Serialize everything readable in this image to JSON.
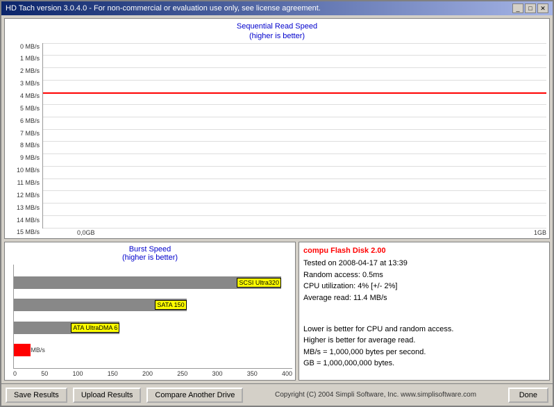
{
  "window": {
    "title": "HD Tach version 3.0.4.0  -  For non-commercial or evaluation use only, see license agreement.",
    "min_btn": "_",
    "max_btn": "□",
    "close_btn": "✕"
  },
  "top_chart": {
    "title_line1": "Sequential Read Speed",
    "title_line2": "(higher is better)",
    "y_labels": [
      "15 MB/s",
      "14 MB/s",
      "13 MB/s",
      "12 MB/s",
      "11 MB/s",
      "10 MB/s",
      "9 MB/s",
      "8 MB/s",
      "7 MB/s",
      "6 MB/s",
      "5 MB/s",
      "4 MB/s",
      "3 MB/s",
      "2 MB/s",
      "1 MB/s",
      "0 MB/s"
    ],
    "x_labels": [
      "0,0GB",
      "1GB"
    ],
    "red_line_pct": 70
  },
  "burst_chart": {
    "title_line1": "Burst Speed",
    "title_line2": "(higher is better)",
    "bars": [
      {
        "label": "SCSI Ultra320",
        "width_pct": 96,
        "color": "gray",
        "value": null
      },
      {
        "label": "SATA 150",
        "width_pct": 62,
        "color": "gray",
        "value": null
      },
      {
        "label": "ATA UltraDMA 6",
        "width_pct": 38,
        "color": "gray",
        "value": null
      },
      {
        "label": null,
        "width_pct": 6,
        "color": "red",
        "value": "11.6 MB/s"
      }
    ],
    "x_labels": [
      "0",
      "50",
      "100",
      "150",
      "200",
      "250",
      "300",
      "350",
      "400"
    ]
  },
  "info_panel": {
    "title": "compu Flash Disk 2.00",
    "line1": "Tested on 2008-04-17 at 13:39",
    "line2": "Random access: 0.5ms",
    "line3": "CPU utilization: 4% [+/- 2%]",
    "line4": "Average read: 11.4 MB/s",
    "separator": "",
    "note1": "Lower is better for CPU and random access.",
    "note2": "Higher is better for average read.",
    "note3": "MB/s = 1,000,000 bytes per second.",
    "note4": "GB = 1,000,000,000 bytes."
  },
  "footer": {
    "save_btn": "Save Results",
    "upload_btn": "Upload Results",
    "compare_btn": "Compare Another Drive",
    "copyright": "Copyright (C) 2004 Simpli Software, Inc.  www.simplisoftware.com",
    "done_btn": "Done"
  }
}
